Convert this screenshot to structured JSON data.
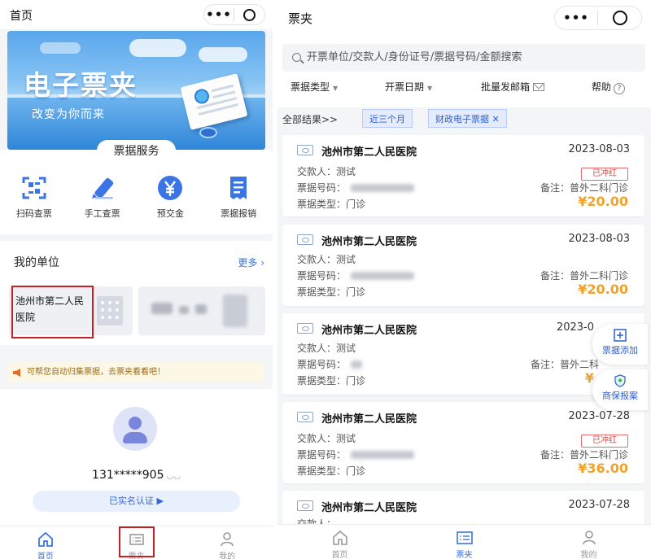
{
  "left": {
    "title": "首页",
    "banner": {
      "title": "电子票夹",
      "subtitle": "改变为你而来"
    },
    "services": {
      "tab_label": "票据服务",
      "items": [
        {
          "label": "扫码查票",
          "icon": "scan-icon"
        },
        {
          "label": "手工查票",
          "icon": "pen-icon"
        },
        {
          "label": "预交金",
          "icon": "yen-icon"
        },
        {
          "label": "票据报销",
          "icon": "receipt-icon"
        }
      ]
    },
    "units": {
      "heading": "我的单位",
      "more": "更多",
      "first_name": "池州市第二人民医院"
    },
    "notice": "可帮您自动归集票据，去票夹看看吧！",
    "user": {
      "phone": "131*****905",
      "verified": "已实名认证 ▶"
    },
    "tabbar": [
      {
        "label": "首页",
        "icon": "home-icon",
        "active": true
      },
      {
        "label": "票夹",
        "icon": "ticket-folder-icon",
        "active": false
      },
      {
        "label": "我的",
        "icon": "profile-icon",
        "active": false
      }
    ]
  },
  "right": {
    "title": "票夹",
    "search_placeholder": "开票单位/交款人/身份证号/票据号码/金额搜索",
    "filters": {
      "type": "票据类型",
      "date": "开票日期",
      "batch": "批量发邮箱",
      "help": "帮助"
    },
    "results_label": "全部结果>>",
    "chips": [
      "近三个月",
      "财政电子票据 ✕"
    ],
    "field_labels": {
      "payer": "交款人：",
      "number": "票据号码：",
      "type": "票据类型：",
      "note": "备注："
    },
    "cards": [
      {
        "hospital": "池州市第二人民医院",
        "date": "2023-08-03",
        "payer": "测试",
        "ticket_type": "门诊",
        "note": "普外二科门诊",
        "stamp": "已冲红",
        "amount": "¥20.00"
      },
      {
        "hospital": "池州市第二人民医院",
        "date": "2023-08-03",
        "payer": "测试",
        "ticket_type": "门诊",
        "note": "普外二科门诊",
        "stamp": "",
        "amount": "¥20.00"
      },
      {
        "hospital": "池州市第二人民医院",
        "date": "2023-0",
        "payer": "测试",
        "ticket_type": "门诊",
        "note": "普外二科",
        "stamp": "",
        "amount": "¥"
      },
      {
        "hospital": "池州市第二人民医院",
        "date": "2023-07-28",
        "payer": "测试",
        "ticket_type": "门诊",
        "note": "普外二科门诊",
        "stamp": "已冲红",
        "amount": "¥36.00"
      },
      {
        "hospital": "池州市第二人民医院",
        "date": "2023-07-28",
        "payer": "",
        "ticket_type": "",
        "note": "",
        "stamp": "",
        "amount": ""
      }
    ],
    "float_buttons": [
      {
        "label": "票据添加",
        "icon": "add-ticket-icon"
      },
      {
        "label": "商保报案",
        "icon": "shield-icon"
      }
    ],
    "tabbar": [
      {
        "label": "首页",
        "icon": "home-icon",
        "active": false
      },
      {
        "label": "票夹",
        "icon": "ticket-folder-icon",
        "active": true
      },
      {
        "label": "我的",
        "icon": "profile-icon",
        "active": false
      }
    ]
  },
  "colors": {
    "accent": "#3b74e4",
    "amount": "#f0a32a",
    "highlight_box": "#c42127",
    "stamp": "#d94545"
  }
}
